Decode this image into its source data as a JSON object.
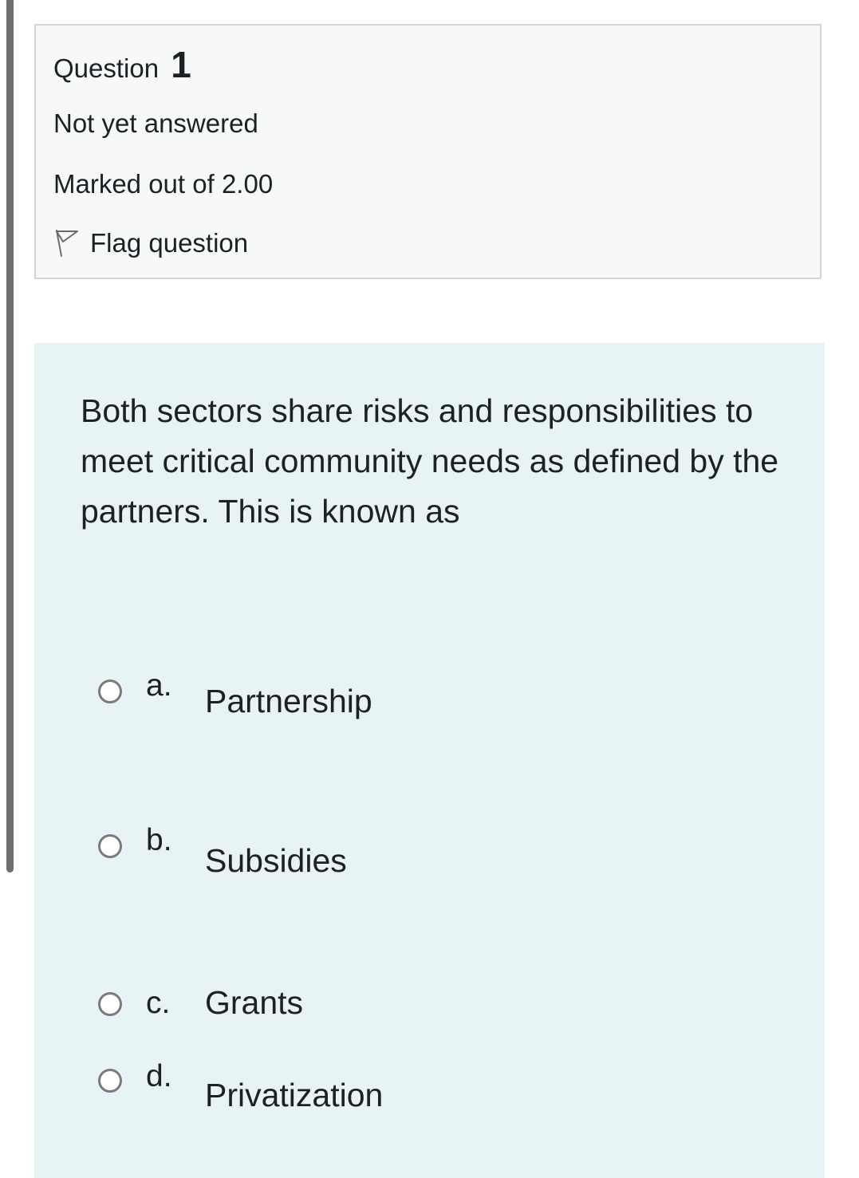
{
  "question": {
    "label": "Question",
    "number": "1",
    "status": "Not yet answered",
    "marks": "Marked out of 2.00",
    "flag_label": "Flag question",
    "flag_icon": "flag-icon"
  },
  "content": {
    "text": "Both sectors share risks and responsibilities to meet critical community needs as defined by the partners. This is known as",
    "options": [
      {
        "letter": "a.",
        "label": "Partnership"
      },
      {
        "letter": "b.",
        "label": "Subsidies"
      },
      {
        "letter": "c.",
        "label": "Grants"
      },
      {
        "letter": "d.",
        "label": "Privatization"
      }
    ]
  },
  "colors": {
    "info_background": "#f7f8f8",
    "content_background": "#e7f3f5",
    "text": "#1d2125"
  }
}
